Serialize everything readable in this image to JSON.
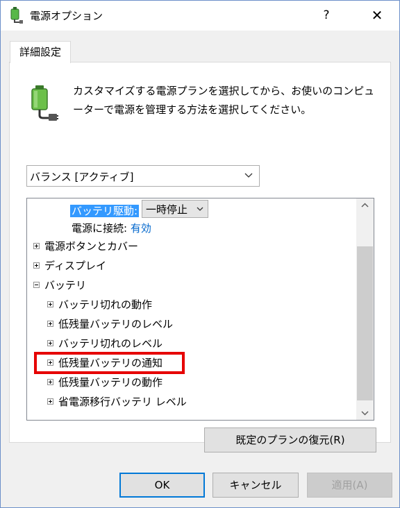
{
  "window": {
    "title": "電源オプション",
    "help_glyph": "?",
    "close_glyph": "✕"
  },
  "tabs": [
    {
      "label": "詳細設定"
    }
  ],
  "description": "カスタマイズする電源プランを選択してから、お使いのコンピューターで電源を管理する方法を選択してください。",
  "plan_select": {
    "value": "バランス [アクティブ]"
  },
  "tree": {
    "rows": [
      {
        "label": "バッテリ駆動:",
        "select_value": "一時停止"
      },
      {
        "label": "電源に接続:",
        "value": "有効"
      },
      {
        "label": "電源ボタンとカバー",
        "expander": "plus"
      },
      {
        "label": "ディスプレイ",
        "expander": "plus"
      },
      {
        "label": "バッテリ",
        "expander": "minus"
      },
      {
        "label": "バッテリ切れの動作",
        "expander": "plus"
      },
      {
        "label": "低残量バッテリのレベル",
        "expander": "plus"
      },
      {
        "label": "バッテリ切れのレベル",
        "expander": "plus"
      },
      {
        "label": "低残量バッテリの通知",
        "expander": "plus"
      },
      {
        "label": "低残量バッテリの動作",
        "expander": "plus"
      },
      {
        "label": "省電源移行バッテリ レベル",
        "expander": "plus"
      }
    ]
  },
  "buttons": {
    "restore": "既定のプランの復元(R)",
    "ok": "OK",
    "cancel": "キャンセル",
    "apply": "適用(A)"
  },
  "colors": {
    "selection": "#3399ff",
    "link": "#0066cc",
    "highlight": "#e60000",
    "focus": "#0078d7"
  }
}
